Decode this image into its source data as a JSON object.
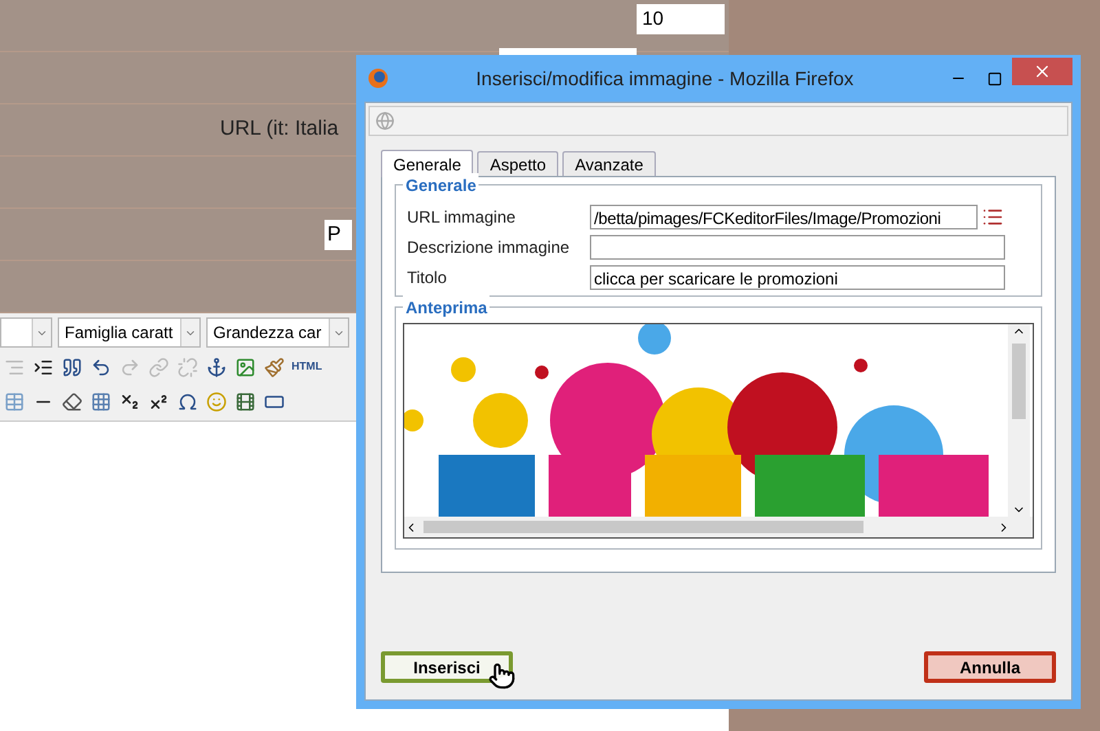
{
  "background": {
    "fields": [
      {
        "value": "10"
      },
      {
        "value": "P"
      }
    ],
    "label": "URL (it: Italia",
    "toolbar": {
      "dropdowns": [
        {
          "value": "Famiglia caratt"
        },
        {
          "value": "Grandezza car"
        }
      ],
      "html_label": "HTML"
    }
  },
  "dialog": {
    "title": "Inserisci/modifica immagine - Mozilla Firefox",
    "tabs": [
      {
        "label": "Generale",
        "selected": true
      },
      {
        "label": "Aspetto",
        "selected": false
      },
      {
        "label": "Avanzate",
        "selected": false
      }
    ],
    "section": "Generale",
    "fields": [
      {
        "label": "URL immagine",
        "value": "/betta/pimages/FCKeditorFiles/Image/Promozioni"
      },
      {
        "label": "Descrizione immagine"
      },
      {
        "label": "Titolo",
        "value": "clicca per scaricare le promozioni"
      }
    ],
    "preview_title": "Anteprima",
    "buttons": [
      {
        "label": "Inserisci",
        "kind": "ok"
      },
      {
        "label": "Annulla",
        "kind": "cancel"
      }
    ]
  }
}
